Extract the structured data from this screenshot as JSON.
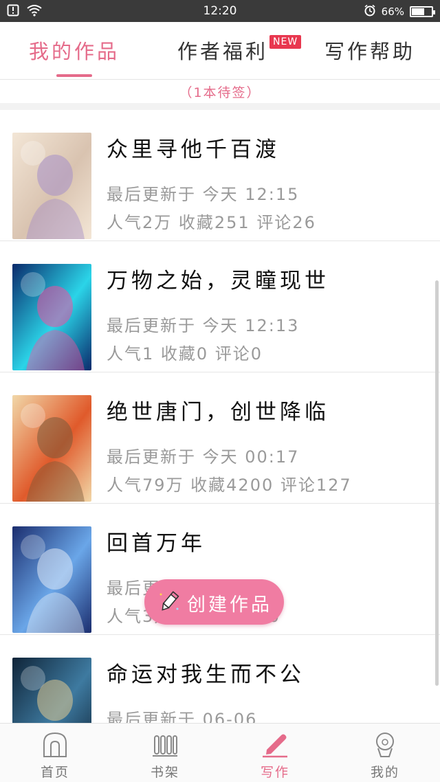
{
  "status_bar": {
    "time": "12:20",
    "battery": "66%",
    "battery_level": 0.66
  },
  "tabs": [
    {
      "label": "我的作品",
      "active": true
    },
    {
      "label": "作者福利",
      "badge": "NEW"
    },
    {
      "label": "写作帮助"
    }
  ],
  "pending_text": "（1本待签）",
  "works": [
    {
      "title": "众里寻他千百渡",
      "updated": "最后更新于 今天 12:15",
      "stats": "人气2万 收藏251 评论26",
      "cover_colors": [
        "#f3e6d6",
        "#d9c3b0",
        "#a58fc8"
      ]
    },
    {
      "title": "万物之始，灵瞳现世",
      "updated": "最后更新于 今天 12:13",
      "stats": "人气1 收藏0 评论0",
      "cover_colors": [
        "#0a2a6b",
        "#2bd4e8",
        "#f04fa0"
      ]
    },
    {
      "title": "绝世唐门，创世降临",
      "updated": "最后更新于 今天 00:17",
      "stats": "人气79万 收藏4200 评论127",
      "cover_colors": [
        "#f1d7a8",
        "#e05a2b",
        "#7a5a3a"
      ]
    },
    {
      "title": "回首万年",
      "updated": "最后更新于 今天",
      "stats": "人气3万 收藏 评论60",
      "cover_colors": [
        "#1b2d6e",
        "#6aa6e8",
        "#dfe8f5"
      ]
    },
    {
      "title": "命运对我生而不公",
      "updated": "最后更新于 06-06",
      "stats": "",
      "cover_colors": [
        "#0f2438",
        "#3e7aa0",
        "#e0c890"
      ]
    }
  ],
  "fab_label": "创建作品",
  "bottom_nav": [
    {
      "label": "首页",
      "icon": "home-icon"
    },
    {
      "label": "书架",
      "icon": "bookshelf-icon"
    },
    {
      "label": "写作",
      "icon": "pen-icon",
      "active": true
    },
    {
      "label": "我的",
      "icon": "profile-icon"
    }
  ],
  "colors": {
    "accent": "#e56b8a",
    "fab": "#f07ca2",
    "badge": "#e8374f"
  }
}
